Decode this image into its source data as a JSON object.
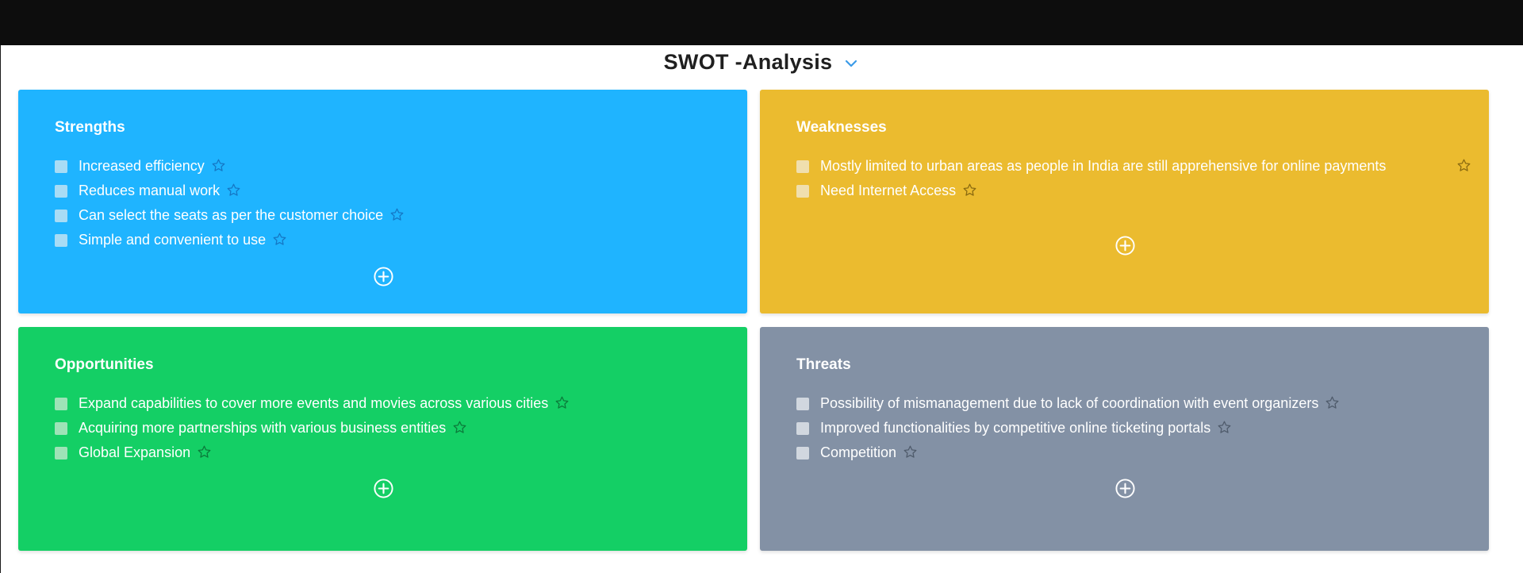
{
  "header": {
    "title": "SWOT -Analysis",
    "dropdown_icon": "chevron-down-icon",
    "accent_color": "#3b9be8"
  },
  "quadrants": {
    "strengths": {
      "title": "Strengths",
      "color": "#1fb4ff",
      "items": [
        "Increased efficiency",
        "Reduces manual work",
        "Can select the seats as per the customer choice",
        "Simple and convenient to use"
      ]
    },
    "weaknesses": {
      "title": "Weaknesses",
      "color": "#ebbb2f",
      "items": [
        "Mostly limited to urban areas as people in India are still apprehensive for online payments",
        "Need Internet Access"
      ]
    },
    "opportunities": {
      "title": "Opportunities",
      "color": "#14cf65",
      "items": [
        "Expand capabilities to cover more events and movies across various cities",
        "Acquiring more partnerships with various business entities",
        "Global Expansion"
      ]
    },
    "threats": {
      "title": "Threats",
      "color": "#8391a5",
      "items": [
        "Possibility of mismanagement due to lack of coordination with event organizers",
        "Improved functionalities by competitive online ticketing portals",
        "Competition"
      ]
    }
  },
  "icons": {
    "item_action": "star-icon",
    "add_action": "add-circle-icon"
  }
}
